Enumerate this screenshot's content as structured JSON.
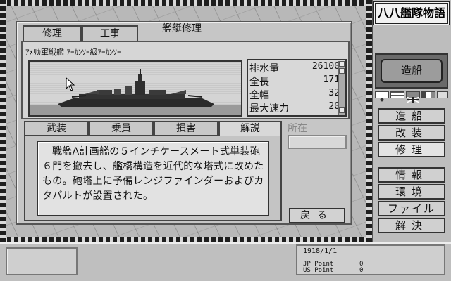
{
  "game_title": "八八艦隊物語",
  "mode_button": "造船",
  "flag_icons": [
    "japan-flag-icon",
    "usa-flag-icon",
    "britain-flag-icon",
    "france-flag-icon",
    "disk-icon"
  ],
  "menu": [
    {
      "label": "造船",
      "active": false
    },
    {
      "label": "改装",
      "active": false
    },
    {
      "label": "修理",
      "active": true
    },
    {
      "label": "情報",
      "active": false
    },
    {
      "label": "環境",
      "active": false
    },
    {
      "label": "ファイル",
      "active": false
    },
    {
      "label": "解決",
      "active": false
    }
  ],
  "dialog": {
    "title": "艦艇修理",
    "top_tabs": [
      "修理",
      "工事"
    ],
    "ship_type": "ｱﾒﾘｶ軍戦艦 ｱｰｶﾝｿｰ級ｱｰｶﾝｿｰ",
    "stats": [
      {
        "label": "排水量",
        "value": "26100"
      },
      {
        "label": "全長",
        "value": "171"
      },
      {
        "label": "全幅",
        "value": "32"
      },
      {
        "label": "最大速力",
        "value": "20"
      }
    ],
    "content_tabs": [
      "武装",
      "乗員",
      "損害",
      "解説"
    ],
    "active_tab": "解説",
    "description": "戦艦A計画艦の５インチケースメート式単装砲６門を撤去し、艦橋構造を近代的な塔式に改めたもの。砲塔上に予備レンジファインダーおよびカタパルトが設置された。",
    "location_label": "所在",
    "location_value": "",
    "back_button": "戻る"
  },
  "status": {
    "date": "1918/1/1",
    "jp_label": "JP Point",
    "jp_value": "0",
    "us_label": "US Point",
    "us_value": "0"
  },
  "colors": {
    "panel": "#c6c6c6",
    "border": "#333333",
    "background": "#b8b8b8"
  }
}
